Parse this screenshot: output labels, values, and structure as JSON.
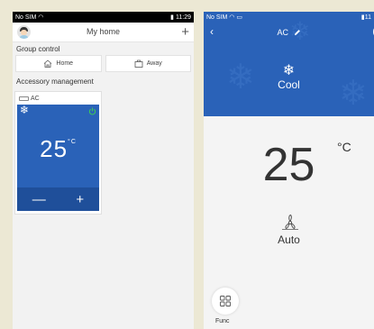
{
  "left": {
    "status": {
      "carrier": "No SIM",
      "time": "11:29"
    },
    "header": {
      "title": "My home",
      "add": "+"
    },
    "group_control": {
      "title": "Group control",
      "home": "Home",
      "away": "Away"
    },
    "accessory": {
      "title": "Accessory management"
    },
    "card": {
      "name": "AC",
      "temp": "25",
      "unit": "°C",
      "minus": "—",
      "plus": "+"
    }
  },
  "right": {
    "status": {
      "carrier": "No SIM",
      "time": "11"
    },
    "nav": {
      "back": "‹",
      "title": "AC"
    },
    "mode": {
      "label": "Cool",
      "glyph": "❄"
    },
    "temp": {
      "value": "25",
      "unit": "°C"
    },
    "fan": {
      "label": "Auto"
    },
    "func": {
      "label": "Func"
    }
  },
  "colors": {
    "accent": "#2a62b8",
    "power": "#3ec65a"
  }
}
